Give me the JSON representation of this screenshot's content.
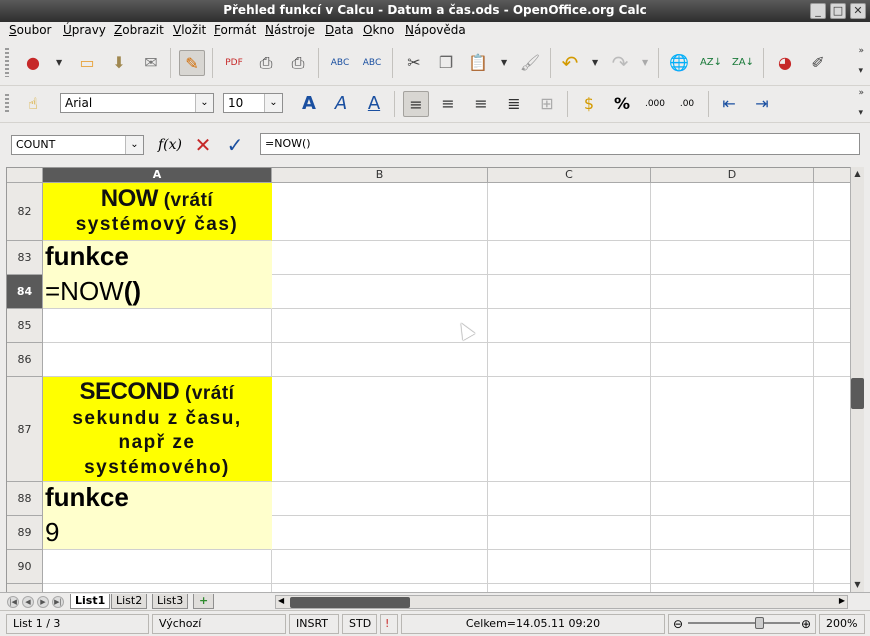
{
  "window": {
    "title": "Přehled funkcí v Calcu - Datum a čas.ods - OpenOffice.org Calc"
  },
  "menu": [
    "Soubor",
    "Úpravy",
    "Zobrazit",
    "Vložit",
    "Formát",
    "Nástroje",
    "Data",
    "Okno",
    "Nápověda"
  ],
  "menu_mnemonic": [
    "S",
    "Ú",
    "Z",
    "V",
    "F",
    "N",
    "D",
    "O",
    "N"
  ],
  "toolbar2": {
    "font_name": "Arial",
    "font_size": "10"
  },
  "formula": {
    "name_box": "COUNT",
    "input": "=NOW()"
  },
  "columns": [
    "A",
    "B",
    "C",
    "D"
  ],
  "rows": [
    "82",
    "83",
    "84",
    "85",
    "86",
    "87",
    "88",
    "89",
    "90"
  ],
  "cells": {
    "a82": {
      "big": "NOW",
      "rest": " (vrátí",
      "line2": "systémový čas)"
    },
    "a83": "funkce",
    "a84": {
      "plain": "=NOW",
      "bold": "()"
    },
    "a87": {
      "big": "SECOND",
      "rest": " (vrátí",
      "line2": "sekundu z času,",
      "line3": "např ze",
      "line4": "systémového)"
    },
    "a88": "funkce",
    "a89": "9"
  },
  "sheets": [
    "List1",
    "List2",
    "List3"
  ],
  "status": {
    "sheet": "List 1 / 3",
    "style": "Výchozí",
    "insert_mode": "INSRT",
    "selection_mode": "STD",
    "sum": "Celkem=14.05.11 09:20",
    "zoom": "200%"
  },
  "colors": {
    "heading_bg": "#ffff00",
    "body_bg": "#ffffcc",
    "selected_header": "#5a5a5a"
  }
}
